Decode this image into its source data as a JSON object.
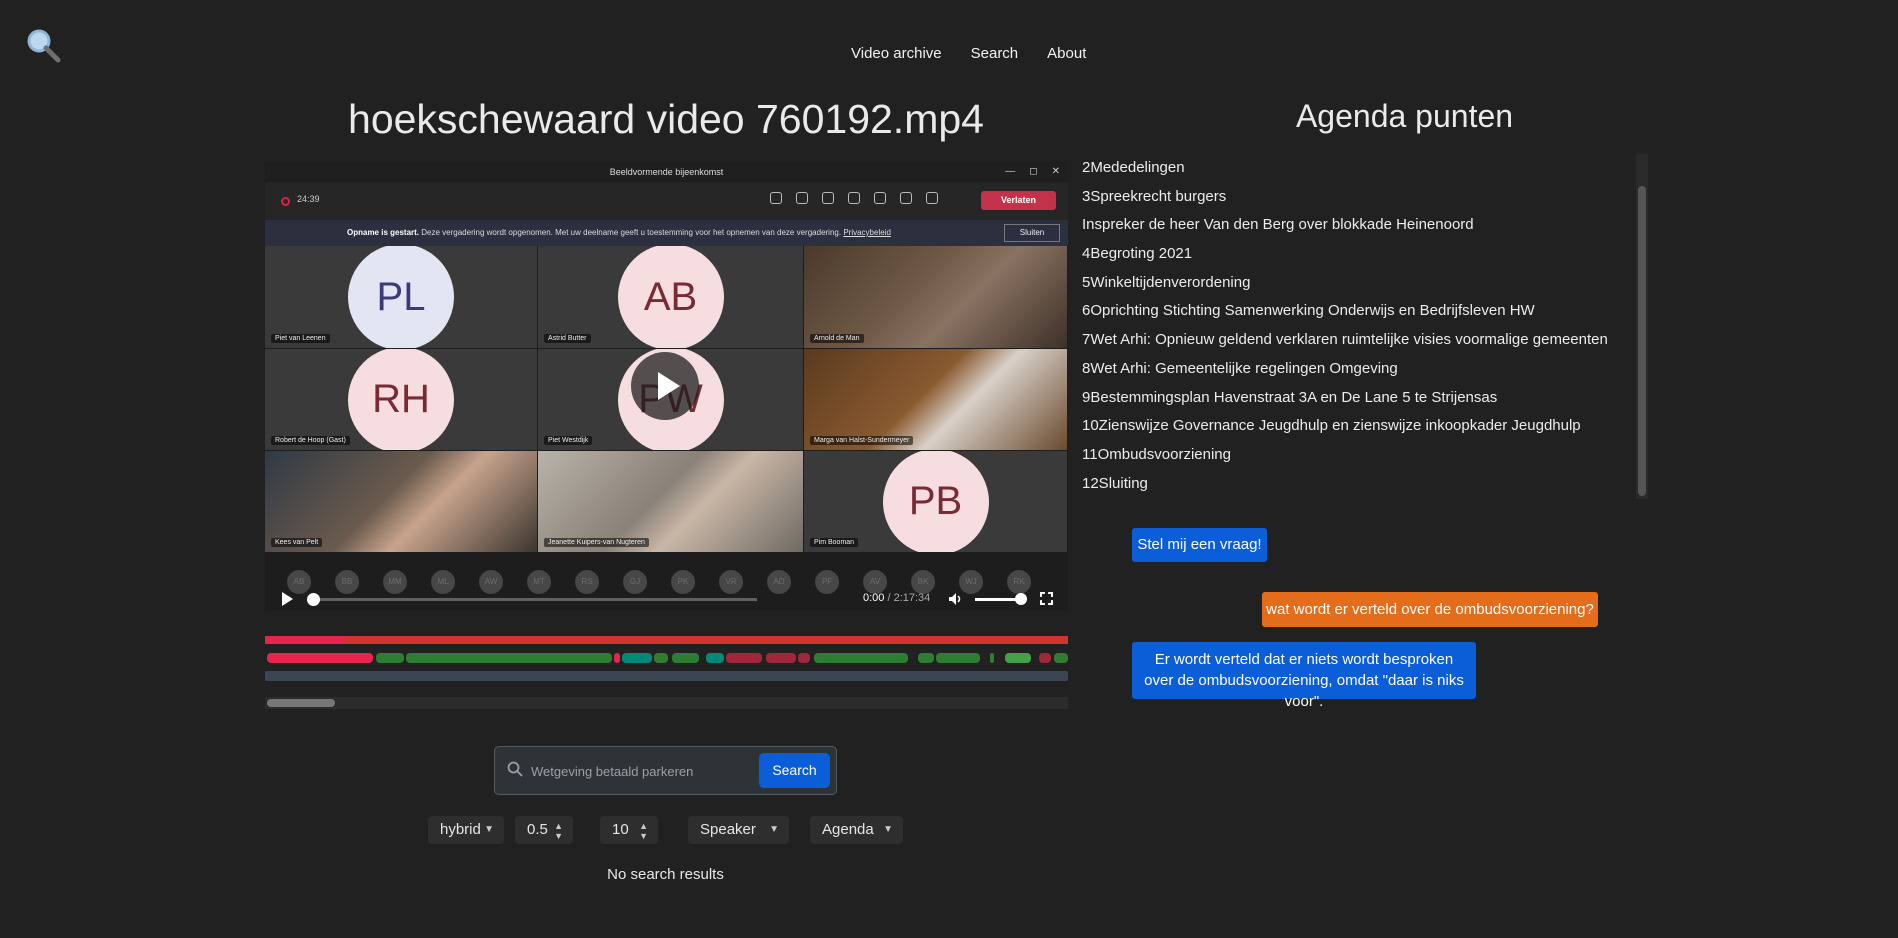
{
  "nav": {
    "items": [
      "Video archive",
      "Search",
      "About"
    ]
  },
  "title": "hoekschewaard video 760192.mp4",
  "video": {
    "window_title": "Beeldvormende bijeenkomst",
    "rec_time": "24:39",
    "leave_label": "Verlaten",
    "notice_bold": "Opname is gestart.",
    "notice_text": "Deze vergadering wordt opgenomen. Met uw deelname geeft u toestemming voor het opnemen van deze vergadering.",
    "notice_link": "Privacybeleid",
    "close_label": "Sluiten",
    "tiles": [
      {
        "initials": "PL",
        "name": "Piet van Leenen"
      },
      {
        "initials": "AB",
        "name": "Astrid Butter"
      },
      {
        "initials": "",
        "name": "Arnold de Man"
      },
      {
        "initials": "RH",
        "name": "Robert de Hoop (Gast)"
      },
      {
        "initials": "PW",
        "name": "Piet Westdijk"
      },
      {
        "initials": "",
        "name": "Marga van Halst-Sundermeyer"
      },
      {
        "initials": "",
        "name": "Kees van Pelt"
      },
      {
        "initials": "",
        "name": "Jeanette Kuipers-van Nugteren"
      },
      {
        "initials": "PB",
        "name": "Pim Booman"
      }
    ],
    "strip": [
      "AB",
      "BB",
      "MM",
      "ML",
      "AW",
      "MT",
      "RS",
      "GJ",
      "PK",
      "VR",
      "AD",
      "PF",
      "AV",
      "BK",
      "WJ",
      "RK"
    ],
    "current_time": "0:00",
    "duration": "/ 2:17:34",
    "volume": 0.85,
    "progress": 0
  },
  "search": {
    "placeholder": "Wetgeving betaald parkeren",
    "button": "Search"
  },
  "filters": {
    "mode": "hybrid",
    "threshold": "0.5",
    "count": "10",
    "speaker": "Speaker",
    "agenda": "Agenda"
  },
  "no_results": "No search results",
  "agenda": {
    "title": "Agenda punten",
    "items": [
      "2Mededelingen",
      "3Spreekrecht burgers",
      "Inspreker de heer Van den Berg over blokkade Heinenoord",
      "4Begroting 2021",
      "5Winkeltijdenverordening",
      "6Oprichting Stichting Samenwerking Onderwijs en Bedrijfsleven HW",
      "7Wet Arhi: Opnieuw geldend verklaren ruimtelijke visies voormalige gemeenten",
      "8Wet Arhi: Gemeentelijke regelingen Omgeving",
      "9Bestemmingsplan Havenstraat 3A en De Lane 5 te Strijensas",
      "10Zienswijze Governance Jeugdhulp en zienswijze inkoopkader Jeugdhulp",
      "11Ombudsvoorziening",
      "12Sluiting"
    ]
  },
  "chat": {
    "ask_button": "Stel mij een vraag!",
    "user_message": "wat wordt er verteld over de ombudsvoorziening?",
    "bot_message": "Er wordt verteld dat er niets wordt besproken over de ombudsvoorziening, omdat \"daar is niks voor\"."
  },
  "colors": {
    "background": "#212121",
    "primary": "#0b5ed7",
    "user_bubble": "#e46d1b",
    "timeline_red": "#d0342c",
    "timeline_pink": "#e8234d",
    "timeline_green": "#2e7d32",
    "timeline_teal": "#00897b",
    "timeline_crimson": "#a0263a"
  }
}
